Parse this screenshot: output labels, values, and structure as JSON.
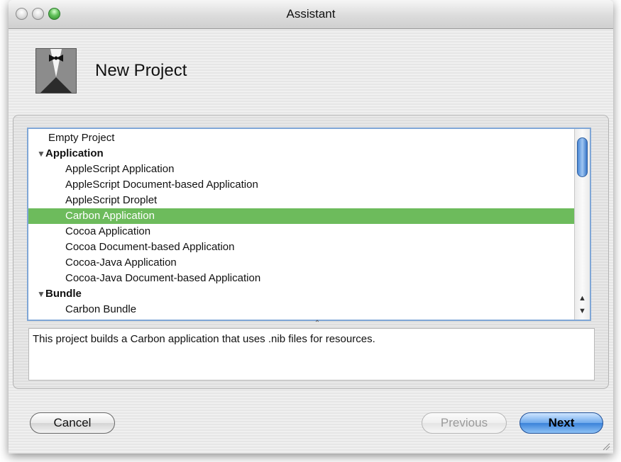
{
  "window": {
    "title": "Assistant"
  },
  "header": {
    "title": "New Project",
    "icon": "tuxedo-icon"
  },
  "list": {
    "rows": [
      {
        "label": "Empty Project",
        "indent": 1,
        "disclosure": "",
        "bold": false,
        "selected": false
      },
      {
        "label": "Application",
        "indent": 0,
        "disclosure": "▼",
        "bold": true,
        "selected": false
      },
      {
        "label": "AppleScript Application",
        "indent": 2,
        "disclosure": "",
        "bold": false,
        "selected": false
      },
      {
        "label": "AppleScript Document-based Application",
        "indent": 2,
        "disclosure": "",
        "bold": false,
        "selected": false
      },
      {
        "label": "AppleScript Droplet",
        "indent": 2,
        "disclosure": "",
        "bold": false,
        "selected": false
      },
      {
        "label": "Carbon Application",
        "indent": 2,
        "disclosure": "",
        "bold": false,
        "selected": true
      },
      {
        "label": "Cocoa Application",
        "indent": 2,
        "disclosure": "",
        "bold": false,
        "selected": false
      },
      {
        "label": "Cocoa Document-based Application",
        "indent": 2,
        "disclosure": "",
        "bold": false,
        "selected": false
      },
      {
        "label": "Cocoa-Java Application",
        "indent": 2,
        "disclosure": "",
        "bold": false,
        "selected": false
      },
      {
        "label": "Cocoa-Java Document-based Application",
        "indent": 2,
        "disclosure": "",
        "bold": false,
        "selected": false
      },
      {
        "label": "Bundle",
        "indent": 0,
        "disclosure": "▼",
        "bold": true,
        "selected": false
      },
      {
        "label": "Carbon Bundle",
        "indent": 2,
        "disclosure": "",
        "bold": false,
        "selected": false
      }
    ],
    "selection_color": "#6dbb5c"
  },
  "description": {
    "text": "This project builds a Carbon application that uses .nib files for resources."
  },
  "buttons": {
    "cancel": "Cancel",
    "previous": "Previous",
    "next": "Next"
  },
  "colors": {
    "accent": "#3b82d9",
    "selection": "#6dbb5c"
  }
}
